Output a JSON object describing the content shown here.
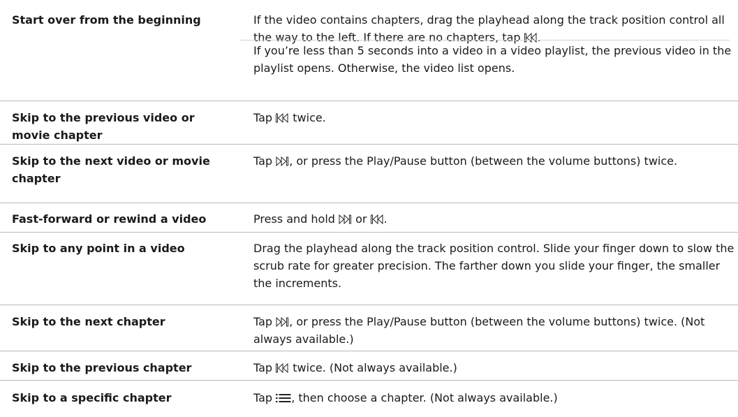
{
  "rows": [
    {
      "action": "Start over from the beginning",
      "desc": "If the video contains chapters, drag the playhead along the track position control all the way to the left. If there are no chapters, tap",
      "desc_end": ".",
      "icon": "previous-icon",
      "desc2": "If you’re less than 5 seconds into a video in a video playlist, the previous video in the playlist opens. Otherwise, the video list opens."
    },
    {
      "action": "Skip to the previous video or movie chapter",
      "desc_pre": "Tap",
      "icon": "previous-icon",
      "desc_post": "twice."
    },
    {
      "action": "Skip to the next video or movie chapter",
      "desc_pre": "Tap",
      "icon": "next-icon",
      "desc_post": ", or press the Play/Pause button (between the volume buttons) twice."
    },
    {
      "action": "Fast-forward or rewind a video",
      "desc_pre": "Press and hold",
      "icon": "next-icon",
      "desc_mid": "or",
      "icon2": "previous-icon",
      "desc_post": "."
    },
    {
      "action": "Skip to any point in a video",
      "desc": "Drag the playhead along the track position control. Slide your finger down to slow the scrub rate for greater precision. The farther down you slide your finger, the smaller the increments."
    },
    {
      "action": "Skip to the next chapter",
      "desc_pre": "Tap",
      "icon": "next-icon",
      "desc_post": ", or press the Play/Pause button (between the volume buttons) twice. (Not always available.)"
    },
    {
      "action": "Skip to the previous chapter",
      "desc_pre": "Tap",
      "icon": "previous-icon",
      "desc_post": "twice. (Not always available.)"
    },
    {
      "action": "Skip to a specific chapter",
      "desc_pre": "Tap",
      "icon": "list-icon",
      "desc_post": ", then choose a chapter. (Not always available.)"
    }
  ]
}
